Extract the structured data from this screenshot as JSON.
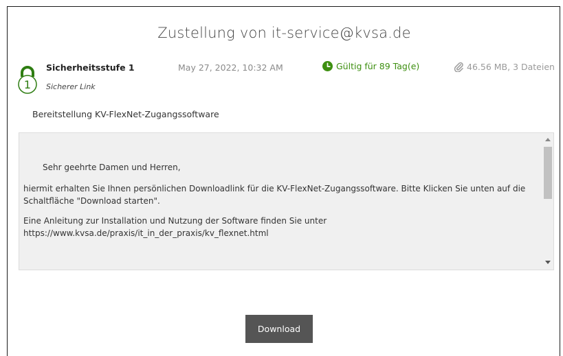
{
  "header": {
    "title": "Zustellung von it-service@kvsa.de"
  },
  "meta": {
    "security_level": "Sicherheitsstufe 1",
    "security_level_number": "1",
    "link_type": "Sicherer Link",
    "date": "May 27, 2022, 10:32 AM",
    "validity": "Gültig für 89 Tag(e)",
    "attachments": "46.56 MB, 3 Dateien",
    "security_icon": "lock-icon",
    "validity_icon": "clock-icon",
    "attachments_icon": "paperclip-icon",
    "colors": {
      "lock": "#2e7d12",
      "valid": "#3d8f10",
      "button": "#555555"
    }
  },
  "message": {
    "subject": "Bereitstellung KV-FlexNet-Zugangssoftware",
    "greeting": "Sehr geehrte Damen und Herren,",
    "paragraph1": "hiermit erhalten Sie Ihnen persönlichen Downloadlink für die KV-FlexNet-Zugangssoftware. Bitte Klicken Sie unten auf die Schaltfläche \"Download starten\".",
    "paragraph2_line1": "Eine Anleitung zur Installation und Nutzung der Software finden Sie unter",
    "paragraph2_line2": "https://www.kvsa.de/praxis/it_in_der_praxis/kv_flexnet.html"
  },
  "actions": {
    "download_label": "Download"
  }
}
